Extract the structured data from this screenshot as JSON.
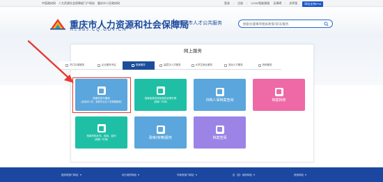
{
  "topbar": {
    "left": [
      "中国政府网",
      "人力资源社会保障部门户网站",
      "重庆市人民政府网"
    ],
    "right": [
      "登录",
      "注册",
      "12333智能客服",
      "无障碍",
      "关怀版"
    ],
    "pill": "网站支持IPv6"
  },
  "header": {
    "bureau": "重庆市人力资源和社会保障局",
    "url": "RLSBJ.CQ.GOV.CN",
    "subtitle": "重庆市人才公共服务",
    "search_placeholder": "搜索办理事项相关政策/资讯/服务"
  },
  "panel": {
    "title": "网上服务"
  },
  "tabs": [
    {
      "label": "热门办事服务",
      "active": false
    },
    {
      "label": "企业服务专区",
      "active": false
    },
    {
      "label": "档案服务",
      "active": true
    },
    {
      "label": "高层次人才服务",
      "active": false
    },
    {
      "label": "大学生就业服务",
      "active": false
    },
    {
      "label": "流动人才服务",
      "active": false
    },
    {
      "label": "其他服务",
      "active": false
    }
  ],
  "tiles": [
    {
      "line1": "档案存放与借阅",
      "line2": "(含流动人员、高校毕业生人员档案接收)",
      "color": "#5ba6dc",
      "icon_color": "#5ba6dc",
      "highlighted": true
    },
    {
      "line1": "档案信息查询及相关证明开具",
      "line2": "(档案一件事)",
      "color": "#1fbfa5",
      "icon_color": "#1fbfa5",
      "highlighted": false
    },
    {
      "line1": "归档人事档案查询",
      "line2": "",
      "color": "#5ba6dc",
      "icon_color": "#5ba6dc",
      "highlighted": false
    },
    {
      "line1": "档案转移",
      "line2": "",
      "color": "#ee6aa6",
      "icon_color": "#ee6aa6",
      "highlighted": false
    },
    {
      "line1": "档案材料补充、查阅、复印",
      "line2": "(档案一件事)",
      "color": "#1fbfa5",
      "icon_color": "#1fbfa5",
      "highlighted": false
    },
    {
      "line1": "政审(考察)服务",
      "line2": "",
      "color": "#5ba6dc",
      "icon_color": "#5ba6dc",
      "highlighted": false
    },
    {
      "line1": "档案查阅",
      "line2": "",
      "color": "#9b84e6",
      "icon_color": "#9b84e6",
      "highlighted": false
    }
  ],
  "footer": [
    "国务院部门网站",
    "地方政府网站",
    "市政府部门网站",
    "区（县）政府网站",
    "其他网站"
  ],
  "colors": {
    "accent": "#1b4e9a",
    "footer": "#1b47a0",
    "highlight": "#e8392f"
  },
  "icons": {
    "search": "search-icon",
    "logo": "bureau-logo"
  }
}
